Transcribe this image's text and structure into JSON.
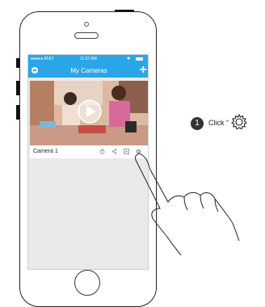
{
  "status_bar": {
    "carrier": "●●●●● AT&T",
    "time": "11:57 AM"
  },
  "nav": {
    "title": "My Cameras",
    "add_symbol": "+"
  },
  "camera_card": {
    "name": "Camera 1"
  },
  "instruction": {
    "step": "1",
    "text": "Click “"
  },
  "icons": [
    "power-icon",
    "share-icon",
    "playback-icon",
    "settings-gear-icon",
    "play-icon",
    "gear-icon"
  ],
  "colors": {
    "accent": "#2aa6e8"
  }
}
